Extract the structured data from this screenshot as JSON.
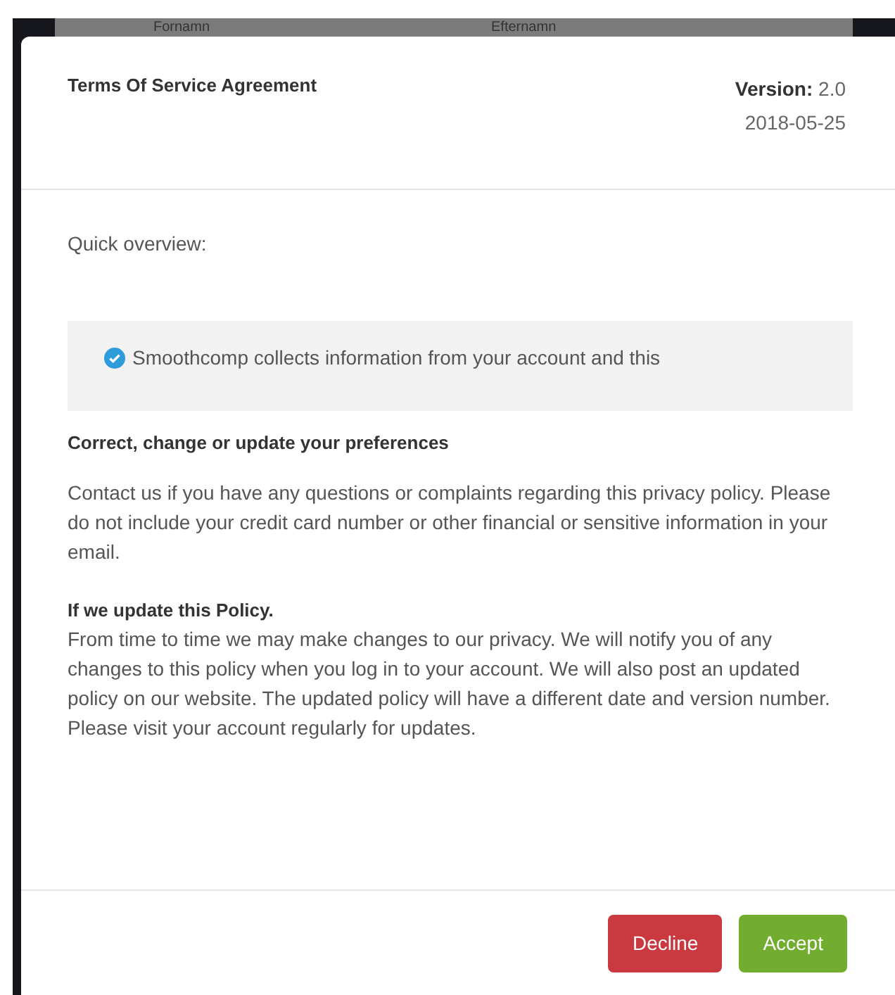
{
  "background_table": {
    "columns": [
      "Fornamn",
      "Efternamn"
    ]
  },
  "modal": {
    "title": "Terms Of Service Agreement",
    "version_label": "Version:",
    "version": "2.0",
    "date": "2018-05-25",
    "overview_label": "Quick overview:",
    "overview_items": [
      "Smoothcomp collects information from your account and this"
    ],
    "sections": [
      {
        "heading": "Correct, change or update your preferences",
        "body": "Contact us if you have any questions or complaints regarding this privacy policy. Please do not include your credit card number or other financial or sensitive information in your email."
      },
      {
        "heading": "If we update this Policy.",
        "body": "From time to time we may make changes to our privacy. We will notify you of any changes to this policy when you log in to your account. We will also post an updated policy on our website. The updated policy will have a different date and version number. Please visit your account regularly for updates."
      }
    ],
    "buttons": [
      {
        "label": "Decline",
        "kind": "danger"
      },
      {
        "label": "Accept",
        "kind": "success"
      }
    ]
  }
}
